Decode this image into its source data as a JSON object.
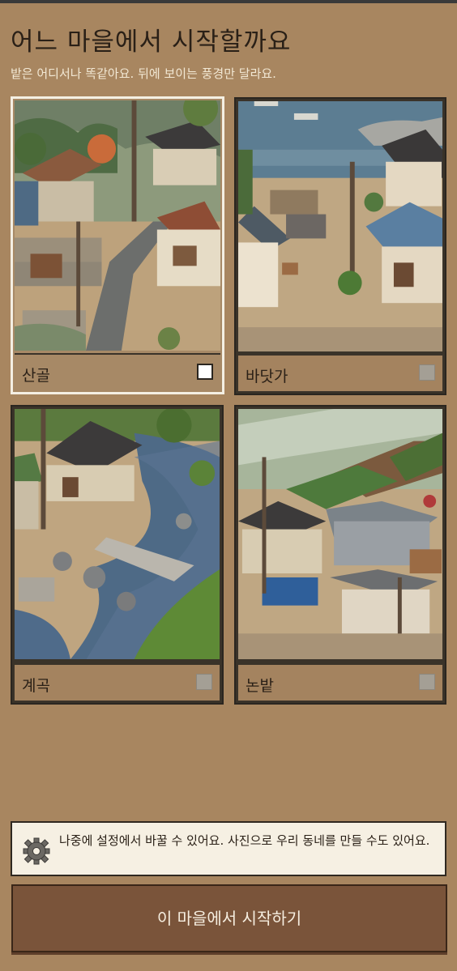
{
  "header": {
    "title": "어느 마을에서 시작할까요",
    "subtitle": "밭은 어디서나 똑같아요. 뒤에 보이는 풍경만 달라요."
  },
  "villages": [
    {
      "name": "산골",
      "selected": true
    },
    {
      "name": "바닷가",
      "selected": false
    },
    {
      "name": "계곡",
      "selected": false
    },
    {
      "name": "논밭",
      "selected": false
    }
  ],
  "info": {
    "icon": "gear-icon",
    "message": "나중에 설정에서 바꿀 수 있어요. 사진으로 우리 동네를 만들 수도 있어요."
  },
  "cta": {
    "label": "이 마을에서 시작하기"
  },
  "colors": {
    "background": "#a88660",
    "button": "#7a543a",
    "selected_border": "#f4efe3"
  }
}
